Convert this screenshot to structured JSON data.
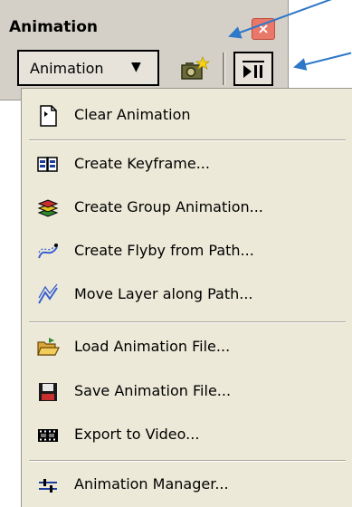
{
  "toolbar": {
    "title": "Animation",
    "close_glyph": "×",
    "dropdown_label": "Animation",
    "dropdown_caret": "▼",
    "camera_icon": "capture-view-icon",
    "play_icon": "animation-controls-icon"
  },
  "menu": {
    "items": [
      {
        "label": "Clear Animation",
        "icon": "clear-animation-icon"
      },
      {
        "label": "Create Keyframe...",
        "icon": "keyframe-icon"
      },
      {
        "label": "Create Group Animation...",
        "icon": "group-animation-icon"
      },
      {
        "label": "Create Flyby from Path...",
        "icon": "flyby-icon"
      },
      {
        "label": "Move Layer along Path...",
        "icon": "move-layer-path-icon"
      },
      {
        "label": "Load Animation File...",
        "icon": "open-folder-icon"
      },
      {
        "label": "Save Animation File...",
        "icon": "save-disk-icon"
      },
      {
        "label": "Export to Video...",
        "icon": "film-strip-icon"
      },
      {
        "label": "Animation Manager...",
        "icon": "animation-manager-icon"
      }
    ]
  },
  "colors": {
    "panel": "#d4d0c8",
    "menu": "#ece9d8",
    "arrow": "#2f78c8",
    "close": "#e8786a"
  }
}
